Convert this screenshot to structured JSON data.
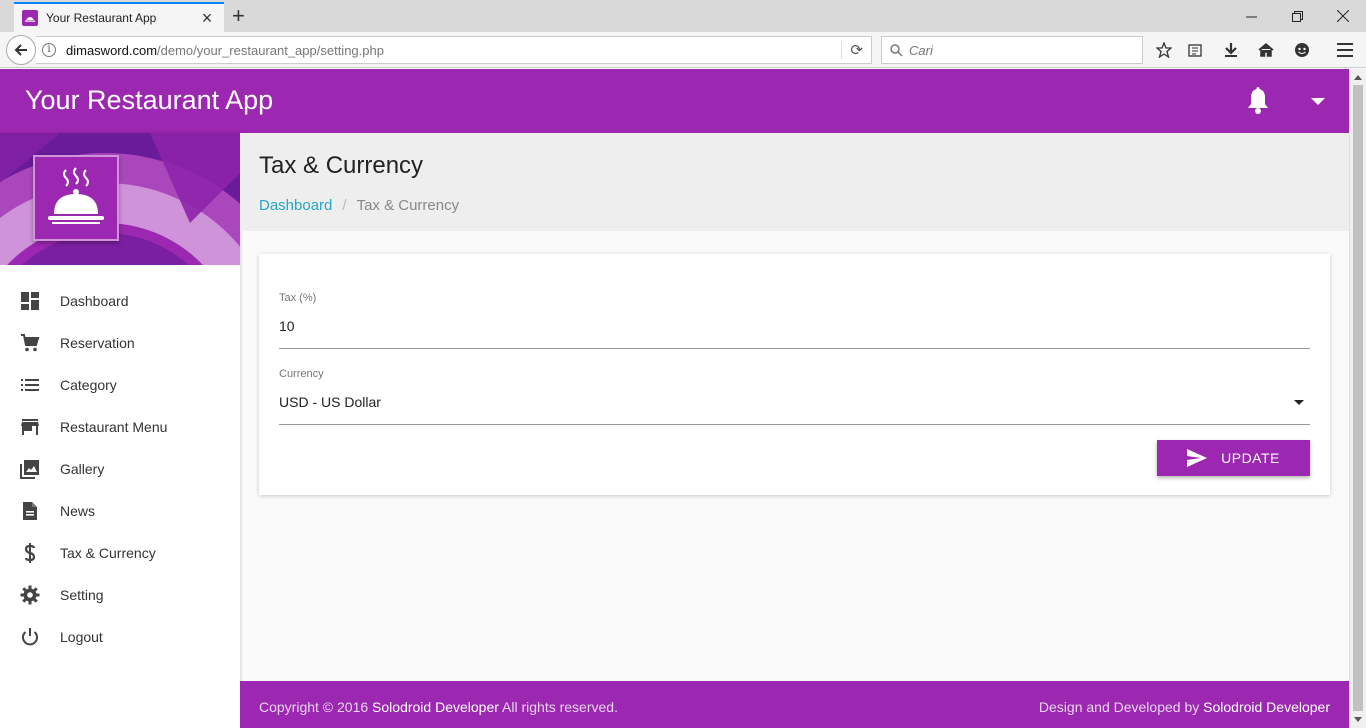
{
  "browser": {
    "tab_title": "Your Restaurant App",
    "url_host": "dimasword.com",
    "url_path": "/demo/your_restaurant_app/setting.php",
    "search_placeholder": "Cari"
  },
  "app": {
    "title": "Your Restaurant App",
    "accent_color": "#9c27b0"
  },
  "sidebar": {
    "items": [
      {
        "label": "Dashboard",
        "icon": "dashboard-icon"
      },
      {
        "label": "Reservation",
        "icon": "cart-icon"
      },
      {
        "label": "Category",
        "icon": "list-icon"
      },
      {
        "label": "Restaurant Menu",
        "icon": "store-icon"
      },
      {
        "label": "Gallery",
        "icon": "gallery-icon"
      },
      {
        "label": "News",
        "icon": "document-icon"
      },
      {
        "label": "Tax & Currency",
        "icon": "dollar-icon"
      },
      {
        "label": "Setting",
        "icon": "gear-icon"
      },
      {
        "label": "Logout",
        "icon": "power-icon"
      }
    ]
  },
  "page": {
    "title": "Tax & Currency",
    "breadcrumb": {
      "home": "Dashboard",
      "separator": "/",
      "current": "Tax & Currency"
    }
  },
  "form": {
    "tax_label": "Tax (%)",
    "tax_value": "10",
    "currency_label": "Currency",
    "currency_value": "USD - US Dollar",
    "update_label": "UPDATE"
  },
  "footer": {
    "copyright_prefix": "Copyright © 2016",
    "copyright_name": "Solodroid Developer",
    "copyright_suffix": "All rights reserved.",
    "credit_prefix": "Design and Developed by",
    "credit_name": "Solodroid Developer"
  }
}
